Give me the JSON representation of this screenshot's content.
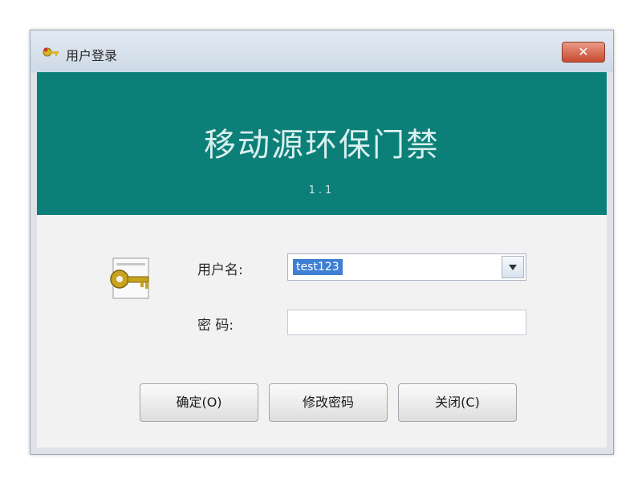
{
  "window": {
    "title": "用户登录",
    "close_label": "✕"
  },
  "banner": {
    "title": "移动源环保门禁",
    "version": "1.1"
  },
  "form": {
    "username_label": "用户名:",
    "username_value": "test123",
    "password_label": "密  码:",
    "password_value": ""
  },
  "buttons": {
    "ok": "确定(O)",
    "change_password": "修改密码",
    "close": "关闭(C)"
  },
  "colors": {
    "banner": "#0c7f78",
    "selection": "#3f7fd3"
  },
  "icons": {
    "app": "key-app-icon",
    "login": "key-icon"
  }
}
